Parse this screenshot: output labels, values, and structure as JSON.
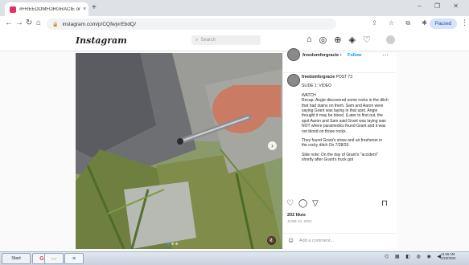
{
  "browser": {
    "tab_title": "#FREEDOMFORGRACIE on Instagr...",
    "tab_close": "×",
    "new_tab": "+",
    "window_controls": "– ❐ ✕",
    "nav": {
      "back": "←",
      "forward": "→",
      "reload": "↻",
      "home": "⌂"
    },
    "lock_icon": "🔒",
    "url": "instagram.com/p/CQfwjvrEbdQ/",
    "url_actions": "⇪ ☆ ⧉ ✱ ▢",
    "profile_label": "Paused",
    "menu": "⋮"
  },
  "instagram": {
    "logo": "Instagram",
    "search_icon": "⌕",
    "search_placeholder": "Search",
    "nav_icons": {
      "home": "⌂",
      "messenger": "◎",
      "new_post": "⊕",
      "explore": "◈",
      "activity": "♡"
    },
    "post": {
      "next_arrow": "›",
      "mute_icon": "🔇",
      "username": "freedomforgracie",
      "separator": "•",
      "follow": "Follow",
      "more": "···",
      "caption_header": "POST 73",
      "caption_paragraphs": [
        "SLIDE 1: VIDEO",
        "WATCH\nRecap: Angie discovered some rocks in the ditch that had stains on them. Sam and Aaron were saying Grant was laying in that spot. Angie thought it may be blood. (Later to find out, the spot Aaron and Sam said Grant was laying was NOT where paramedics found Grant and it was not blood on those rocks.",
        "They found Grant's straw and air freshener in the rocky ditch On 7/28/20.",
        "Side note: On the day of Grant's \"accident\" shortly after Grant's truck got"
      ],
      "actions": {
        "like": "♡",
        "comment": "◯",
        "share": "▽",
        "save": "⊓"
      },
      "likes": "202 likes",
      "date": "JUNE 24, 2021",
      "emoji_icon": "☺",
      "comment_placeholder": "Add a comment..."
    }
  },
  "taskbar": {
    "start": "Start",
    "apps": [
      "G",
      "▭",
      "≡"
    ],
    "tray": "⌬ ▦ ◧ ◍ ◉ ◀",
    "clock_time": "11:56 AM",
    "clock_date": "2/23/2022"
  },
  "colors": {
    "follow": "#0095f6",
    "favicon": "#e1306c",
    "grass": "#7a8c5e"
  }
}
